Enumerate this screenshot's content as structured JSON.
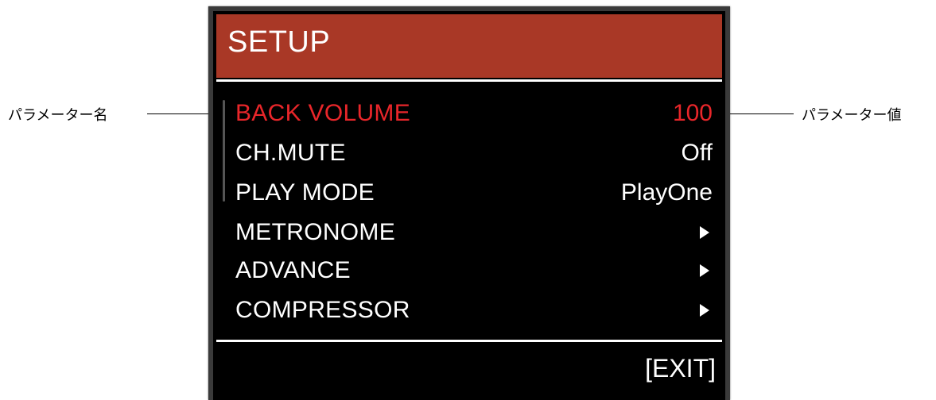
{
  "header": {
    "title": "SETUP"
  },
  "menu": {
    "items": [
      {
        "label": "BACK VOLUME",
        "value": "100",
        "selected": true
      },
      {
        "label": "CH.MUTE",
        "value": "Off"
      },
      {
        "label": "PLAY MODE",
        "value": "PlayOne"
      },
      {
        "label": "METRONOME",
        "icon": "chevron-right-icon"
      },
      {
        "label": "ADVANCE",
        "icon": "chevron-right-icon"
      },
      {
        "label": "COMPRESSOR",
        "icon": "chevron-right-icon"
      }
    ]
  },
  "footer": {
    "exit_label": "[EXIT]"
  },
  "callouts": {
    "param_name": "パラメーター名",
    "param_value": "パラメーター値"
  },
  "colors": {
    "header_bg": "#a93826",
    "selected_text": "#e8262a",
    "screen_bg": "#000000"
  }
}
